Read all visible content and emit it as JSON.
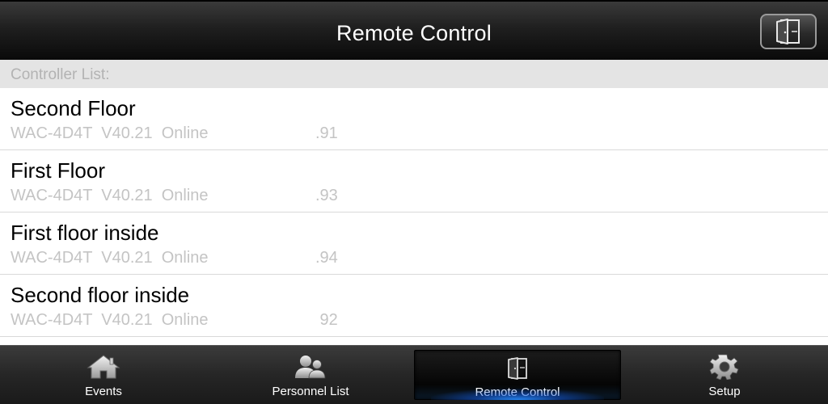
{
  "header": {
    "title": "Remote Control",
    "action_icon": "door-exit-icon"
  },
  "section": {
    "title": "Controller List:"
  },
  "controllers": [
    {
      "name": "Second Floor",
      "details": "WAC-4D4T  V40.21  Online",
      "ip": ".91"
    },
    {
      "name": "First Floor",
      "details": "WAC-4D4T  V40.21  Online",
      "ip": ".93"
    },
    {
      "name": "First floor inside",
      "details": "WAC-4D4T  V40.21  Online",
      "ip": ".94"
    },
    {
      "name": "Second floor inside",
      "details": "WAC-4D4T  V40.21  Online",
      "ip": " 92"
    }
  ],
  "nav": {
    "items": [
      {
        "label": "Events",
        "icon": "house-icon"
      },
      {
        "label": "Personnel List",
        "icon": "people-icon"
      },
      {
        "label": "Remote Control",
        "icon": "door-exit-icon"
      },
      {
        "label": "Setup",
        "icon": "gear-icon"
      }
    ],
    "active_index": 2
  },
  "colors": {
    "header_bg": "#1f1f1f",
    "section_bg": "#e4e4e4",
    "secondary_text": "#c4c4c4",
    "active_glow": "#288cff"
  }
}
